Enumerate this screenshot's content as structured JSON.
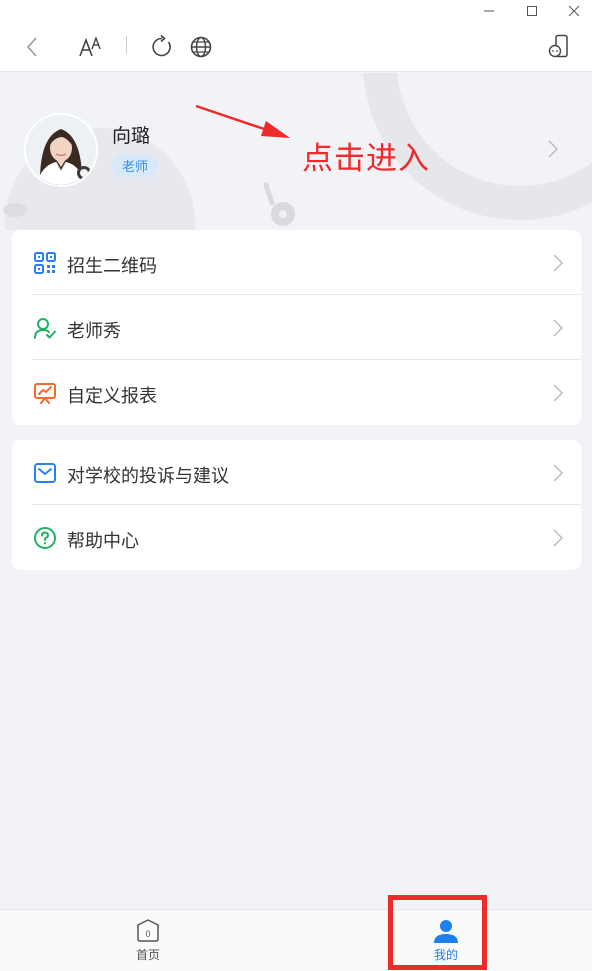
{
  "window": {
    "minimize_icon": "minimize-icon",
    "maximize_icon": "maximize-icon",
    "close_icon": "close-icon"
  },
  "toolbar": {
    "icons": [
      "back-icon",
      "font-size-icon",
      "refresh-icon",
      "globe-icon",
      "mobile-device-icon"
    ]
  },
  "profile": {
    "name": "向璐",
    "role": "老师",
    "annotation": "点击进入"
  },
  "menu_group_1": [
    {
      "label": "招生二维码",
      "icon": "qr-code-icon",
      "color": "#2b7ef5"
    },
    {
      "label": "老师秀",
      "icon": "user-icon",
      "color": "#1fb264"
    },
    {
      "label": "自定义报表",
      "icon": "chart-board-icon",
      "color": "#f26a2e"
    }
  ],
  "menu_group_2": [
    {
      "label": "对学校的投诉与建议",
      "icon": "mail-icon",
      "color": "#2b7ef5"
    },
    {
      "label": "帮助中心",
      "icon": "help-icon",
      "color": "#1fb264"
    }
  ],
  "bottom_nav": {
    "home_label": "首页",
    "home_badge": "0",
    "mine_label": "我的",
    "active_color": "#1e7ff0",
    "inactive_color": "#555555"
  }
}
